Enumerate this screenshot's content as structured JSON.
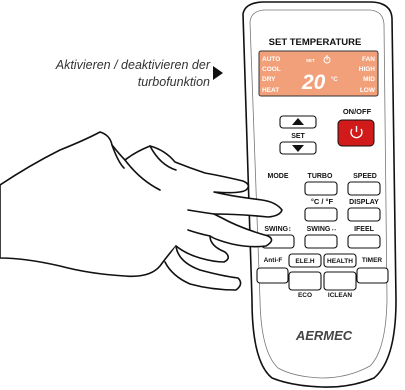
{
  "caption": {
    "line1": "Aktivieren / deaktivieren der",
    "line2": "turbofunktion"
  },
  "remote": {
    "header": "SET TEMPERATURE",
    "lcd": {
      "modes_left": [
        "AUTO",
        "COOL",
        "DRY",
        "HEAT"
      ],
      "modes_right": [
        "FAN",
        "HIGH",
        "MID",
        "LOW"
      ],
      "set_label": "SET",
      "temperature": "20",
      "unit": "°C"
    },
    "buttons": {
      "set": "SET",
      "onoff": "ON/OFF",
      "mode": "MODE",
      "turbo": "TURBO",
      "speed": "SPEED",
      "unit_toggle": "°C / °F",
      "display": "DISPLAY",
      "swing_v": "SWING↕",
      "swing_h": "SWING↔",
      "ifeel": "IFEEL",
      "antif": "Anti-F",
      "eleh": "ELE.H",
      "health": "HEALTH",
      "timer": "TIMER",
      "eco": "ECO",
      "iclean": "ICLEAN"
    },
    "brand": "AERMEC"
  },
  "colors": {
    "lcd": "#f2a07a",
    "power_button": "#d11a1a",
    "remote_body": "#ffffff",
    "outline": "#111111"
  },
  "icons": [
    "arrow-up-icon",
    "arrow-down-icon",
    "power-icon",
    "fan-icon",
    "pointer-triangle-icon"
  ]
}
